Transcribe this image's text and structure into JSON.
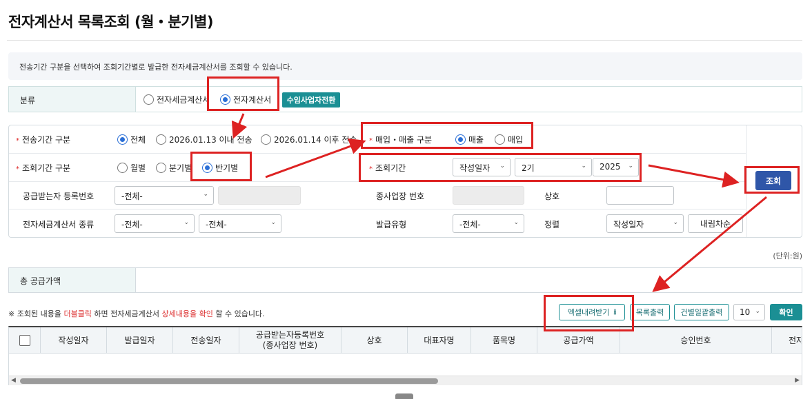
{
  "title": "전자계산서 목록조회 (월・분기별)",
  "info": "전송기간 구분을 선택하여 조회기간별로 발급한 전자세금계산서를 조회할 수 있습니다.",
  "category": {
    "label": "분류",
    "options": [
      "전자세금계산서",
      "전자계산서"
    ],
    "selected": "전자계산서",
    "switch_button": "수임사업자전환"
  },
  "search": {
    "transmission": {
      "label": "전송기간 구분",
      "options": [
        "전체",
        "2026.01.13 이내 전송",
        "2026.01.14 이후 전송"
      ],
      "selected": "전체"
    },
    "trade": {
      "label": "매입・매출 구분",
      "options": [
        "매출",
        "매입"
      ],
      "selected": "매출"
    },
    "period_type": {
      "label": "조회기간 구분",
      "options": [
        "월별",
        "분기별",
        "반기별"
      ],
      "selected": "반기별"
    },
    "period": {
      "label": "조회기간",
      "date_type": "작성일자",
      "half": "2기",
      "year": "2025"
    },
    "receiver_reg_no": {
      "label": "공급받는자 등록번호",
      "value": "-전체-"
    },
    "sub_business_no": {
      "label": "종사업장 번호"
    },
    "company": {
      "label": "상호"
    },
    "invoice_type": {
      "label": "전자세금계산서 종류",
      "value1": "-전체-",
      "value2": "-전체-"
    },
    "issue_type": {
      "label": "발급유형",
      "value": "-전체-"
    },
    "sort": {
      "label": "정렬",
      "value": "작성일자",
      "order": "내림차순"
    },
    "query_button": "조회"
  },
  "unit": "(단위:원)",
  "total_supply": {
    "label": "총 공급가액"
  },
  "note": {
    "prefix": "※ 조회된 내용을 ",
    "red1": "더블클릭",
    "mid": " 하면 전자세금계산서 ",
    "red2": "상세내용을 확인",
    "suffix": " 할 수 있습니다."
  },
  "actions": {
    "excel": "엑셀내려받기",
    "print_list": "목록출력",
    "bulk_print": "건별일괄출력",
    "page_size": "10",
    "confirm": "확인"
  },
  "table": {
    "columns": [
      "작성일자",
      "발급일자",
      "전송일자",
      "공급받는자등록번호\n(종사업장 번호)",
      "상호",
      "대표자명",
      "품목명",
      "공급가액",
      "승인번호",
      "전자"
    ]
  },
  "colors": {
    "teal": "#1b8f94",
    "query_blue": "#2f56a8",
    "radio_blue": "#2b6fd6",
    "highlight_red": "#dd2222"
  }
}
